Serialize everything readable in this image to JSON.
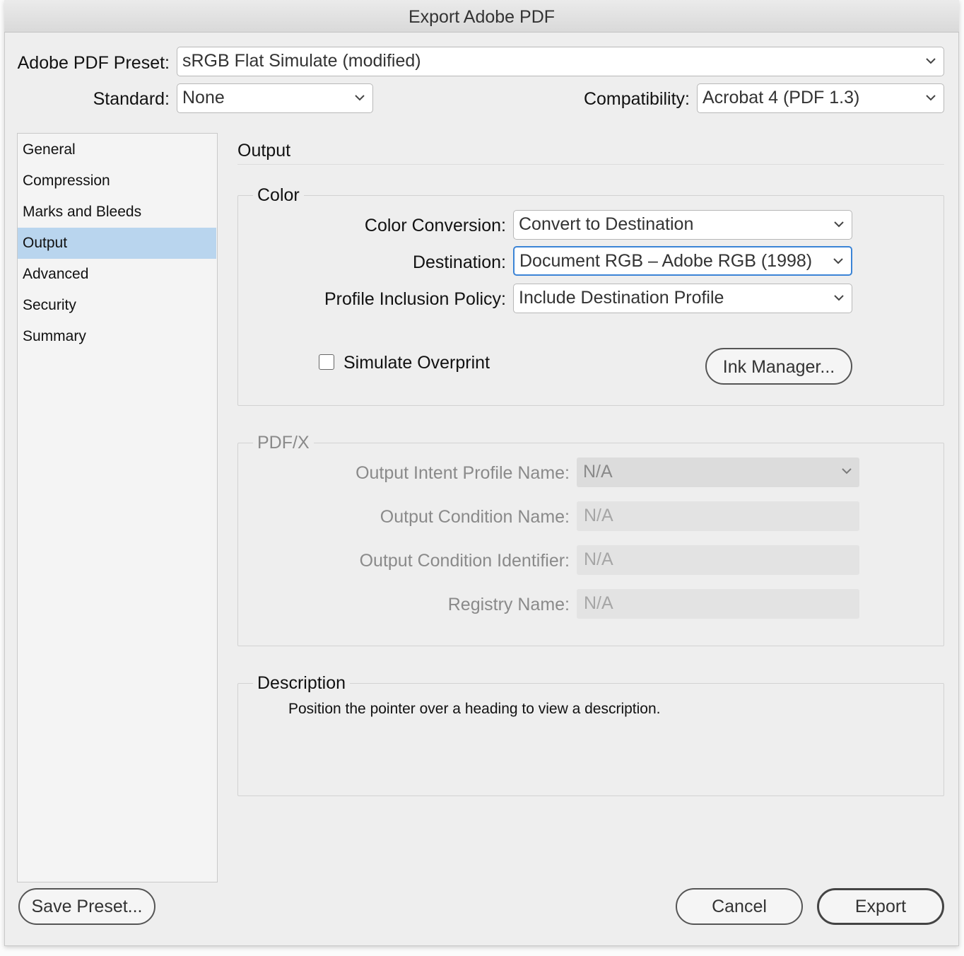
{
  "window": {
    "title": "Export Adobe PDF"
  },
  "header": {
    "preset_label": "Adobe PDF Preset:",
    "preset_value": "sRGB Flat Simulate (modified)",
    "standard_label": "Standard:",
    "standard_value": "None",
    "compat_label": "Compatibility:",
    "compat_value": "Acrobat 4 (PDF 1.3)"
  },
  "sidebar": {
    "items": [
      {
        "label": "General"
      },
      {
        "label": "Compression"
      },
      {
        "label": "Marks and Bleeds"
      },
      {
        "label": "Output"
      },
      {
        "label": "Advanced"
      },
      {
        "label": "Security"
      },
      {
        "label": "Summary"
      }
    ],
    "selected": "Output"
  },
  "main": {
    "section_title": "Output",
    "color": {
      "legend": "Color",
      "conversion_label": "Color Conversion:",
      "conversion_value": "Convert to Destination",
      "destination_label": "Destination:",
      "destination_value": "Document RGB – Adobe RGB (1998)",
      "policy_label": "Profile Inclusion Policy:",
      "policy_value": "Include Destination Profile",
      "simulate_label": "Simulate Overprint",
      "simulate_checked": false,
      "ink_button": "Ink Manager..."
    },
    "pdfx": {
      "legend": "PDF/X",
      "intent_label": "Output Intent Profile Name:",
      "intent_value": "N/A",
      "condition_label": "Output Condition Name:",
      "condition_value": "N/A",
      "identifier_label": "Output Condition Identifier:",
      "identifier_value": "N/A",
      "registry_label": "Registry Name:",
      "registry_value": "N/A"
    },
    "description": {
      "legend": "Description",
      "text": "Position the pointer over a heading to view a description."
    }
  },
  "footer": {
    "save_preset": "Save Preset...",
    "cancel": "Cancel",
    "export": "Export"
  },
  "colors": {
    "selection": "#b9d5ee",
    "focus": "#3b84d6"
  },
  "icons": {
    "dropdown": "chevron-down-icon",
    "checkbox": "checkbox-unchecked"
  }
}
